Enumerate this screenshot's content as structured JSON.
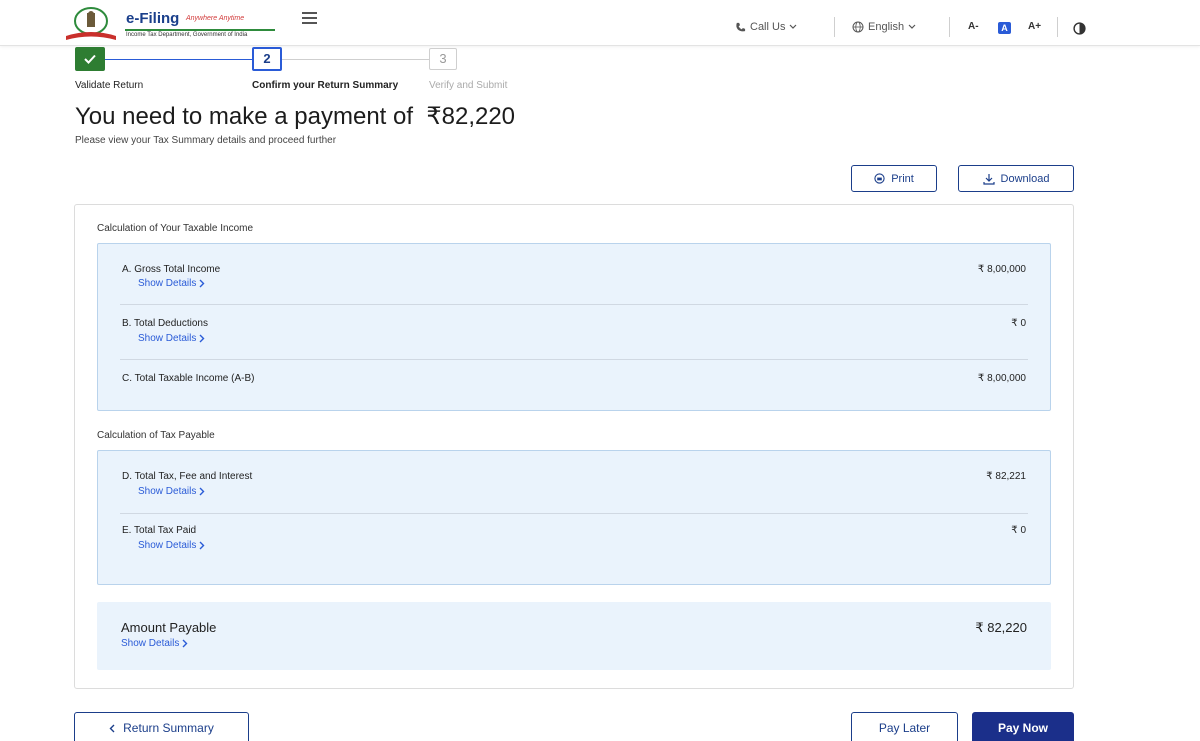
{
  "header": {
    "logo_title": "e-Filing",
    "logo_tagline": "Anywhere Anytime",
    "logo_subtitle": "Income Tax Department, Government of India",
    "call_us": "Call Us",
    "language": "English",
    "font_decrease": "A-",
    "font_default": "A",
    "font_increase": "A+"
  },
  "stepper": {
    "steps": [
      {
        "number": "✓",
        "label": "Validate Return",
        "state": "done"
      },
      {
        "number": "2",
        "label": "Confirm your Return Summary",
        "state": "active"
      },
      {
        "number": "3",
        "label": "Verify and Submit",
        "state": "future"
      }
    ]
  },
  "page": {
    "title": "You need to make a payment of  ₹82,220",
    "subtitle": "Please view your Tax Summary details and proceed further"
  },
  "actions": {
    "print": "Print",
    "download": "Download"
  },
  "taxable_income": {
    "section_title": "Calculation of Your Taxable Income",
    "rows": [
      {
        "label": "A. Gross Total Income",
        "value": "₹ 8,00,000",
        "link": "Show Details"
      },
      {
        "label": "B. Total Deductions",
        "value": "₹ 0",
        "link": "Show Details"
      },
      {
        "label": "C. Total Taxable Income (A-B)",
        "value": "₹ 8,00,000",
        "link": ""
      }
    ]
  },
  "tax_payable": {
    "section_title": "Calculation of Tax Payable",
    "rows": [
      {
        "label": "D. Total Tax, Fee and Interest",
        "value": "₹ 82,221",
        "link": "Show Details"
      },
      {
        "label": "E. Total Tax Paid",
        "value": "₹ 0",
        "link": "Show Details"
      }
    ]
  },
  "amount_payable": {
    "label": "Amount Payable",
    "value": "₹ 82,220",
    "link": "Show Details"
  },
  "footer": {
    "back_label": "Return Summary",
    "pay_later_label": "Pay Later",
    "pay_now_label": "Pay Now"
  },
  "colors": {
    "primary": "#1b2f8a",
    "accent_blue": "#2a5bd7",
    "success": "#2e7d32",
    "panel_bg": "#eaf3fc"
  }
}
